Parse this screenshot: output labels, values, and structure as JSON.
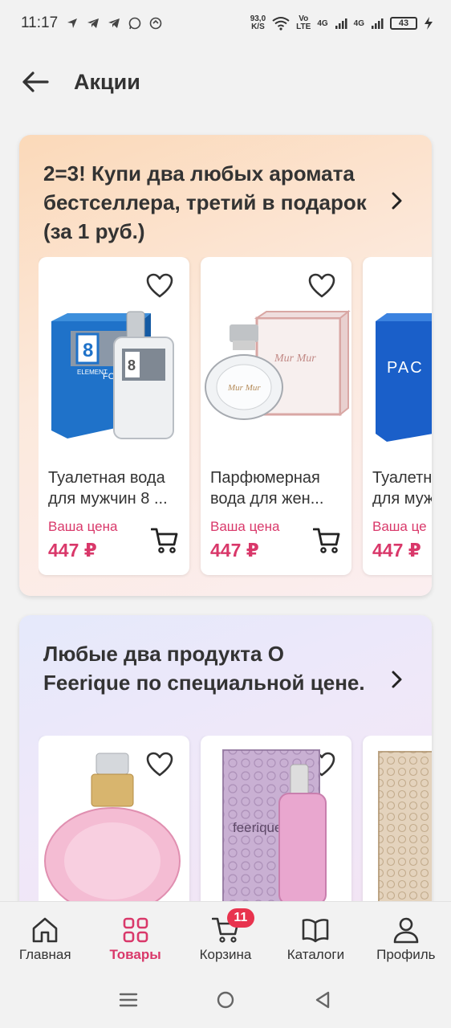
{
  "status_bar": {
    "time": "11:17",
    "net_speed_value": "93,0",
    "net_speed_unit": "K/S",
    "volte_top": "Vo",
    "volte_bottom": "LTE",
    "sig1": "4G",
    "sig2": "4G",
    "battery": "43"
  },
  "header": {
    "title": "Акции"
  },
  "promos": [
    {
      "title": "2=3! Купи два любых аромата бестселлера, третий в подарок (за 1 руб.)",
      "products": [
        {
          "name_line1": "Туалетная вода",
          "name_line2": "для мужчин 8 ...",
          "price_label": "Ваша цена",
          "price": "447 ₽",
          "box_text": "FOR MEN",
          "box_brand": "8",
          "box_sub": "ELEMENT"
        },
        {
          "name_line1": "Парфюмерная",
          "name_line2": "вода для жен...",
          "price_label": "Ваша цена",
          "price": "447 ₽",
          "box_text": "Mur Mur"
        },
        {
          "name_line1": "Туалетная",
          "name_line2": "для муж",
          "price_label": "Ваша це",
          "price": "447 ₽",
          "box_text": "PAC"
        }
      ]
    },
    {
      "title": "Любые два продукта O Feerique по специальной цене.",
      "products": [
        {
          "name_line1": "",
          "name_line2": ""
        },
        {
          "name_line1": "",
          "name_line2": "",
          "box_text": "feerique"
        },
        {
          "name_line1": "",
          "name_line2": ""
        }
      ]
    }
  ],
  "bottom_nav": {
    "items": [
      {
        "label": "Главная",
        "icon": "home-icon"
      },
      {
        "label": "Товары",
        "icon": "grid-icon",
        "active": true
      },
      {
        "label": "Корзина",
        "icon": "cart-icon",
        "badge": "11"
      },
      {
        "label": "Каталоги",
        "icon": "book-icon"
      },
      {
        "label": "Профиль",
        "icon": "profile-icon"
      }
    ]
  },
  "colors": {
    "accent": "#d9386a",
    "badge": "#e8334e",
    "text": "#333333"
  }
}
